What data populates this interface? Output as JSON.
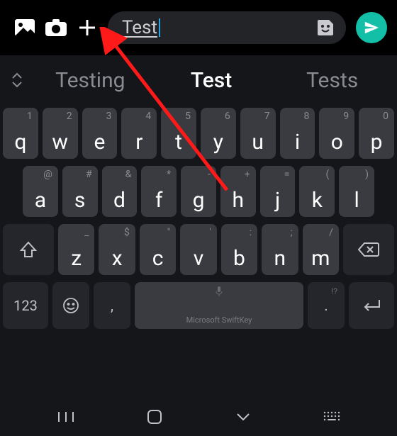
{
  "input": {
    "text": "Test"
  },
  "suggestions": {
    "left": "Testing",
    "center": "Test",
    "right": "Tests"
  },
  "row1": [
    {
      "m": "q",
      "s": "1"
    },
    {
      "m": "w",
      "s": "2"
    },
    {
      "m": "e",
      "s": "3"
    },
    {
      "m": "r",
      "s": "4"
    },
    {
      "m": "t",
      "s": "5"
    },
    {
      "m": "y",
      "s": "6"
    },
    {
      "m": "u",
      "s": "7"
    },
    {
      "m": "i",
      "s": "8"
    },
    {
      "m": "o",
      "s": "9"
    },
    {
      "m": "p",
      "s": "0"
    }
  ],
  "row2": [
    {
      "m": "a",
      "s": "@"
    },
    {
      "m": "s",
      "s": "#"
    },
    {
      "m": "d",
      "s": "&"
    },
    {
      "m": "f",
      "s": "*"
    },
    {
      "m": "g",
      "s": "-"
    },
    {
      "m": "h",
      "s": "+"
    },
    {
      "m": "j",
      "s": "="
    },
    {
      "m": "k",
      "s": "("
    },
    {
      "m": "l",
      "s": ")"
    }
  ],
  "row3": [
    {
      "m": "z",
      "s": "_"
    },
    {
      "m": "x",
      "s": "$"
    },
    {
      "m": "c",
      "s": "\""
    },
    {
      "m": "v",
      "s": "'"
    },
    {
      "m": "b",
      "s": ":"
    },
    {
      "m": "n",
      "s": ";"
    },
    {
      "m": "m",
      "s": "/"
    }
  ],
  "bottom": {
    "num": "123",
    "comma": ",",
    "period": ".",
    "period_sub": "!?",
    "brand": "Microsoft SwiftKey"
  }
}
